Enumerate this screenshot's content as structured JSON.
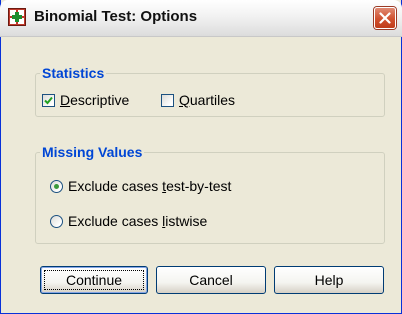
{
  "dialog": {
    "title": "Binomial Test: Options"
  },
  "statistics": {
    "legend": "Statistics",
    "options": [
      {
        "label": "Descriptive",
        "checked": true
      },
      {
        "label": "Quartiles",
        "checked": false
      }
    ]
  },
  "missing_values": {
    "legend": "Missing Values",
    "options": [
      {
        "label": "Exclude cases test-by-test",
        "selected": true
      },
      {
        "label": "Exclude cases listwise",
        "selected": false
      }
    ]
  },
  "buttons": {
    "continue": "Continue",
    "cancel": "Cancel",
    "help": "Help"
  },
  "colors": {
    "legend_text": "#0046d5",
    "title_bar": "#f2f2f2",
    "close_button": "#d0502e",
    "dialog_background": "#ece9d8",
    "radio_dot": "#3b9a3b"
  }
}
